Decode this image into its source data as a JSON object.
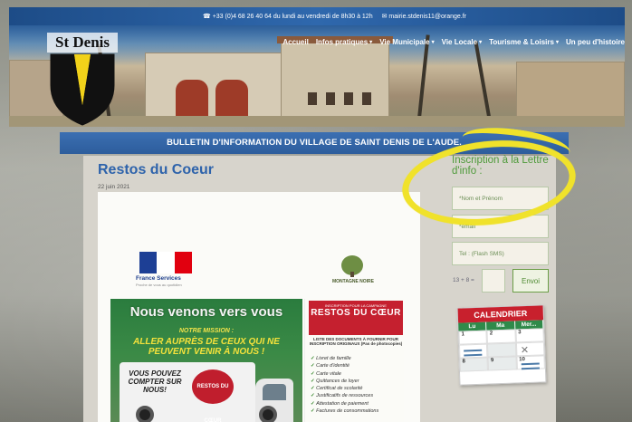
{
  "topbar": {
    "phone": "+33 (0)4 68 26 40 64 du lundi au vendredi de 8h30 à 12h",
    "email": "mairie.stdenis11@orange.fr"
  },
  "nav": {
    "items": [
      {
        "label": "Accueil",
        "has_caret": false
      },
      {
        "label": "Infos pratiques",
        "has_caret": true
      },
      {
        "label": "Vie Municipale",
        "has_caret": true
      },
      {
        "label": "Vie Locale",
        "has_caret": true
      },
      {
        "label": "Tourisme & Loisirs",
        "has_caret": true
      },
      {
        "label": "Un peu d'histoire",
        "has_caret": false
      }
    ]
  },
  "logo": {
    "title": "St Denis"
  },
  "bulletin": {
    "text": "BULLETIN D'INFORMATION DU VILLAGE DE SAINT DENIS DE L'AUDE."
  },
  "post": {
    "title": "Restos du Coeur",
    "date": "22 juin 2021"
  },
  "flyer": {
    "france_services": "France Services",
    "france_services_sub": "Proche de vous au quotidien",
    "montagne_noire": "MONTAGNE NOIRE",
    "headline": "Nous venons vers vous",
    "mission": "NOTRE MISSION :",
    "slogan": "ALLER AUPRÈS DE CEUX QUI NE PEUVENT VENIR À NOUS !",
    "truck_text": "VOUS POUVEZ COMPTER SUR NOUS!",
    "badge": "RESTOS DU CŒUR",
    "right_small": "INSCRIPTION POUR LA CAMPAGNE",
    "right_title": "RESTOS DU CŒUR",
    "right_info": "LISTE DES DOCUMENTS À FOURNIR POUR INSCRIPTION ORIGINAUX (Pas de photocopies)",
    "checklist": [
      "Livret de famille",
      "Carte d'identité",
      "Carte vitale",
      "Quittances de loyer",
      "Certificat de scolarité",
      "Justificatifs de ressources",
      "Attestation de paiement",
      "Factures de consommations"
    ]
  },
  "sidebar": {
    "title": "Inscription à la Lettre d'info :",
    "name_placeholder": "*Nom et Prénom",
    "email_placeholder": "*email",
    "tel_placeholder": "Tel : (Flash SMS)",
    "captcha": "13 + 8 =",
    "submit": "Envoi"
  },
  "calendar": {
    "title": "CALENDRIER",
    "days": [
      "Lu",
      "Ma",
      "Mer..."
    ],
    "dates": [
      "1",
      "2",
      "3",
      "",
      "",
      "",
      "8",
      "9",
      "10"
    ]
  },
  "colors": {
    "brand_blue": "#2d5d9c",
    "title_blue": "#2e63ab",
    "sidebar_green": "#4e9a3a",
    "annotation_yellow": "#f0e22b",
    "calendar_red": "#c8202d"
  }
}
